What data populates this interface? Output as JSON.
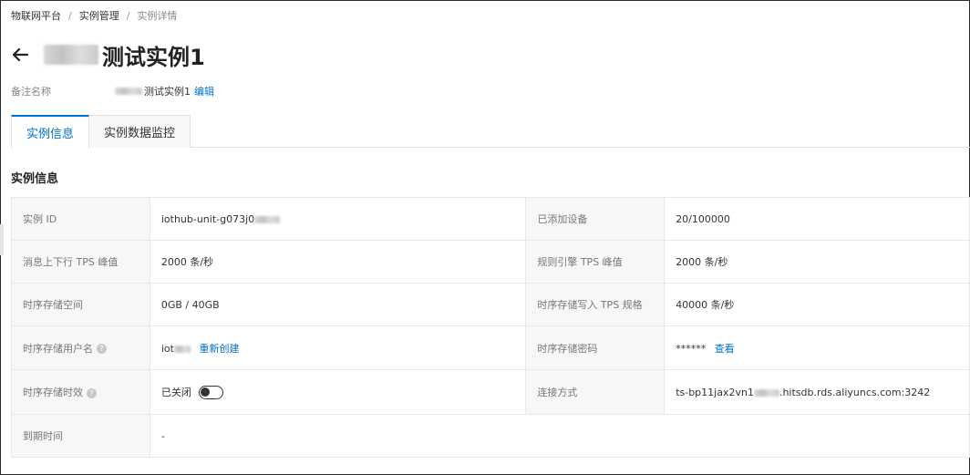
{
  "breadcrumb": {
    "items": [
      "物联网平台",
      "实例管理",
      "实例详情"
    ],
    "separator": "/"
  },
  "header": {
    "title": "测试实例1",
    "back_icon": "arrow-left-icon"
  },
  "remark": {
    "label": "备注名称",
    "value": "测试实例1",
    "edit_label": "编辑"
  },
  "tabs": [
    {
      "label": "实例信息",
      "active": true
    },
    {
      "label": "实例数据监控",
      "active": false
    }
  ],
  "section": {
    "title": "实例信息"
  },
  "info": {
    "instance_id": {
      "label": "实例 ID",
      "value": "iothub-unit-g073j0"
    },
    "devices_added": {
      "label": "已添加设备",
      "value": "20/100000"
    },
    "msg_tps": {
      "label": "消息上下行 TPS 峰值",
      "value": "2000 条/秒"
    },
    "rule_tps": {
      "label": "规则引擎 TPS 峰值",
      "value": "2000 条/秒"
    },
    "ts_storage": {
      "label": "时序存储空间",
      "value": "0GB / 40GB"
    },
    "ts_write_tps": {
      "label": "时序存储写入 TPS 规格",
      "value": "40000 条/秒"
    },
    "ts_username": {
      "label": "时序存储用户名",
      "value": "iot",
      "action": "重新创建"
    },
    "ts_password": {
      "label": "时序存储密码",
      "value": "******",
      "action": "查看"
    },
    "ts_ttl": {
      "label": "时序存储时效",
      "value": "已关闭",
      "toggle_on": false
    },
    "connection": {
      "label": "连接方式",
      "value_prefix": "ts-bp11jax2vn1",
      "value_suffix": ".hitsdb.rds.aliyuncs.com:3242"
    },
    "expire": {
      "label": "到期时间",
      "value": "-"
    }
  },
  "colors": {
    "accent": "#0070cc",
    "label_bg": "#f7f7f7",
    "border": "#e8e8e8"
  }
}
